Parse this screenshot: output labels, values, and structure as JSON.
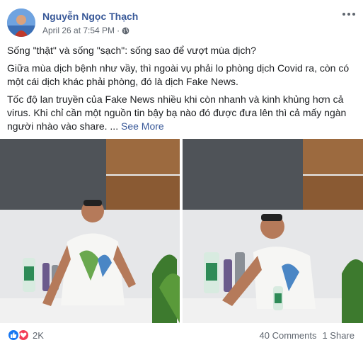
{
  "post": {
    "author": "Nguyễn Ngọc Thạch",
    "timestamp": "April 26 at 7:54 PM",
    "separator": "·",
    "privacy_icon": "globe-icon",
    "more_icon": "more-options-icon",
    "paragraphs": [
      "Sống \"thật\" và sống \"sạch\": sống sao để vượt mùa dịch?",
      "Giữa mùa dịch bệnh như vầy, thì ngoài vụ phải lo phòng dịch Covid ra, còn có một cái dịch khác phải phòng, đó là dịch Fake News.",
      "Tốc độ lan truyền của Fake News nhiều khi còn nhanh và kinh khủng hơn cả virus. Khi chỉ cần một nguồn tin bậy bạ nào đó được đưa lên thì cả mấy ngàn người nhào vào share. ..."
    ],
    "see_more": "See More"
  },
  "footer": {
    "reaction_count": "2K",
    "comments": "40 Comments",
    "shares": "1 Share"
  },
  "colors": {
    "author": "#385898",
    "like": "#1877f2",
    "love": "#f33e58",
    "meta": "#606770"
  }
}
